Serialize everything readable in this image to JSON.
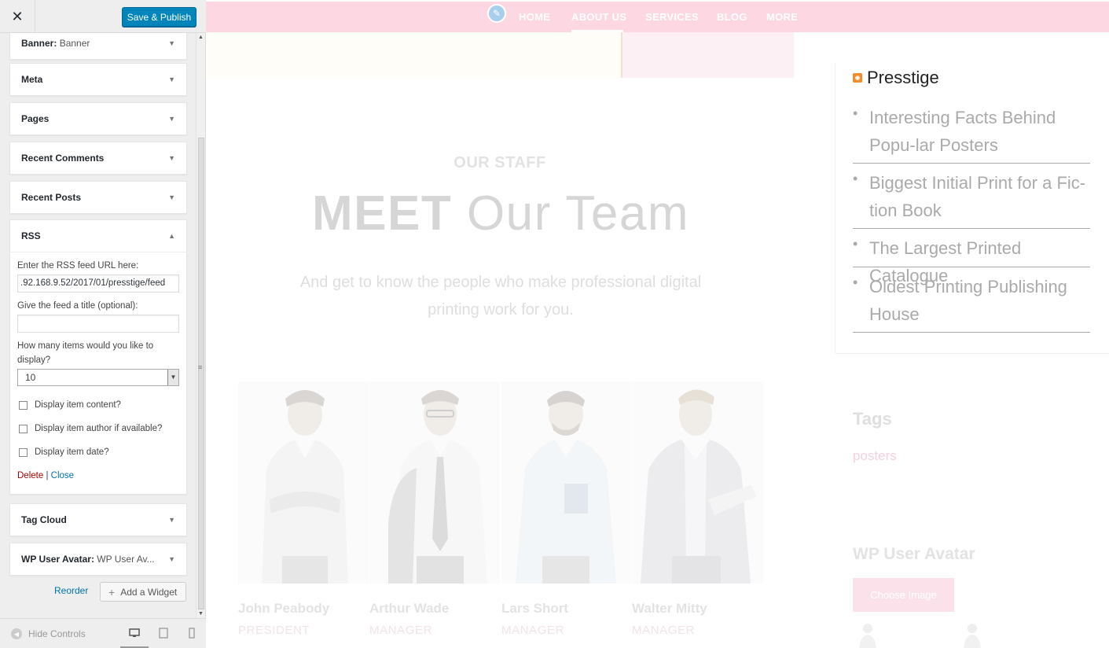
{
  "customizer": {
    "close_icon": "close-icon",
    "save_label": "Save & Publish",
    "widgets": [
      {
        "name": "Banner",
        "sub": "Banner"
      },
      {
        "name": "Meta",
        "sub": ""
      },
      {
        "name": "Pages",
        "sub": ""
      },
      {
        "name": "Recent Comments",
        "sub": ""
      },
      {
        "name": "Recent Posts",
        "sub": ""
      },
      {
        "name": "RSS",
        "sub": ""
      },
      {
        "name": "Tag Cloud",
        "sub": ""
      },
      {
        "name": "WP User Avatar",
        "sub": "WP User Av..."
      }
    ],
    "rss_form": {
      "url_label": "Enter the RSS feed URL here:",
      "url_value": ".92.168.9.52/2017/01/presstige/feed",
      "title_label": "Give the feed a title (optional):",
      "title_value": "",
      "items_label": "How many items would you like to display?",
      "items_value": "10",
      "show_content": "Display item content?",
      "show_author": "Display item author if available?",
      "show_date": "Display item date?",
      "delete_label": "Delete",
      "separator": "|",
      "close_label": "Close"
    },
    "reorder_label": "Reorder",
    "add_widget_label": "Add a Widget",
    "hide_controls_label": "Hide Controls",
    "colors": {
      "primary": "#0085ba",
      "link": "#0073aa",
      "delete": "#a00"
    }
  },
  "preview": {
    "nav": [
      "HOME",
      "ABOUT US",
      "SERVICES",
      "BLOG",
      "MORE"
    ],
    "nav_active": "ABOUT US",
    "staff_label": "OUR STAFF",
    "title_bold": "MEET",
    "title_rest": " Our Team",
    "subtitle": "And get to know the people who make professional digital printing work for you.",
    "team": [
      {
        "name": "John Peabody",
        "role": "PRESIDENT"
      },
      {
        "name": "Arthur Wade",
        "role": "MANAGER"
      },
      {
        "name": "Lars Short",
        "role": "MANAGER"
      },
      {
        "name": "Walter Mitty",
        "role": "MANAGER"
      }
    ],
    "rss_widget": {
      "title": "Presstige",
      "items": [
        "Interesting Facts Behind Popu-lar Posters",
        "Biggest Initial Print for a Fic-tion Book",
        "The Largest Printed Catalogue",
        "Oldest Printing Publishing House"
      ]
    },
    "tags_title": "Tags",
    "tag": "posters",
    "wpua_title": "WP User Avatar",
    "choose_image": "Choose Image",
    "colors": {
      "nav_bg": "#fdd8e2",
      "accent_pink": "#f6d0dc"
    }
  }
}
